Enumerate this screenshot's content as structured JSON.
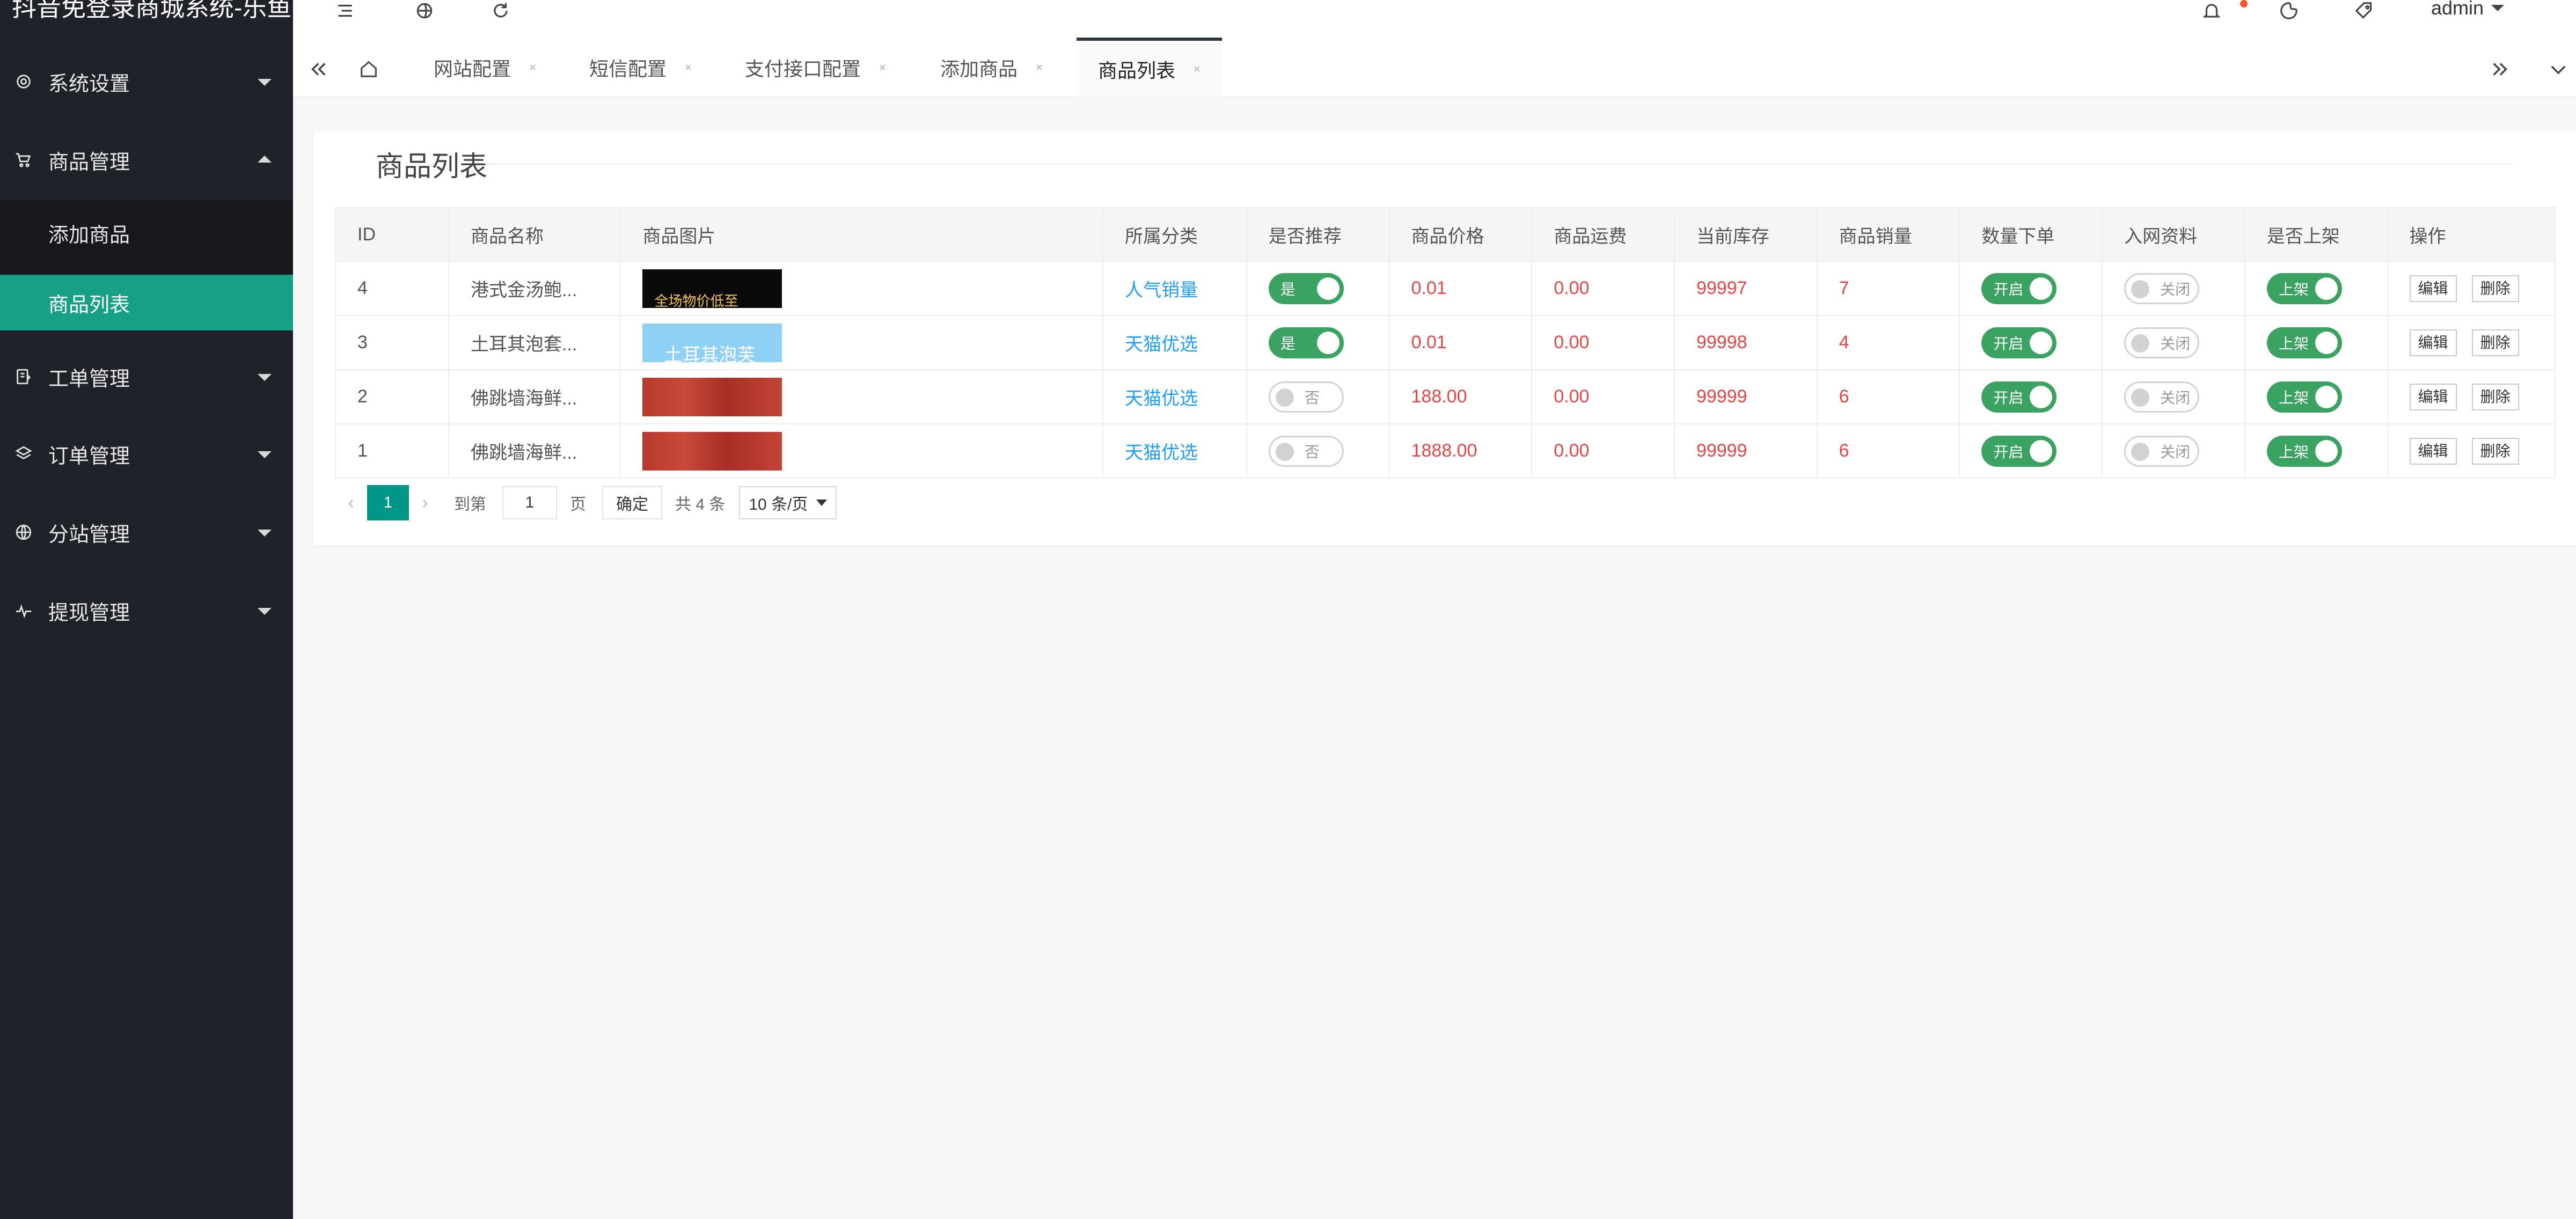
{
  "app": {
    "title": "抖音免登录商城系统-乐鱼"
  },
  "sidebar": {
    "items": [
      {
        "label": "系统设置",
        "icon": "settings-icon"
      },
      {
        "label": "商品管理",
        "icon": "cart-icon"
      },
      {
        "label": "工单管理",
        "icon": "ticket-icon"
      },
      {
        "label": "订单管理",
        "icon": "layers-icon"
      },
      {
        "label": "分站管理",
        "icon": "globe-icon"
      },
      {
        "label": "提现管理",
        "icon": "pulse-icon"
      }
    ],
    "submenu": [
      {
        "label": "添加商品"
      },
      {
        "label": "商品列表"
      }
    ]
  },
  "header": {
    "user": "admin"
  },
  "tabs": [
    {
      "label": "网站配置"
    },
    {
      "label": "短信配置"
    },
    {
      "label": "支付接口配置"
    },
    {
      "label": "添加商品"
    },
    {
      "label": "商品列表"
    }
  ],
  "card": {
    "title": "商品列表"
  },
  "table": {
    "headers": [
      "ID",
      "商品名称",
      "商品图片",
      "所属分类",
      "是否推荐",
      "商品价格",
      "商品运费",
      "当前库存",
      "商品销量",
      "数量下单",
      "入网资料",
      "是否上架",
      "操作"
    ],
    "rows": [
      {
        "id": "4",
        "name": "港式金汤鲍...",
        "image_text": "全场物价低至",
        "category": "人气销量",
        "recommend": "是",
        "price": "0.01",
        "shipping": "0.00",
        "stock": "99997",
        "sales": "7",
        "qty_order": "开启",
        "network": "关闭",
        "onsale": "上架"
      },
      {
        "id": "3",
        "name": "土耳其泡套...",
        "image_text": "土耳其泡芙",
        "category": "天猫优选",
        "recommend": "是",
        "price": "0.01",
        "shipping": "0.00",
        "stock": "99998",
        "sales": "4",
        "qty_order": "开启",
        "network": "关闭",
        "onsale": "上架"
      },
      {
        "id": "2",
        "name": "佛跳墙海鲜...",
        "image_text": "",
        "category": "天猫优选",
        "recommend": "否",
        "price": "188.00",
        "shipping": "0.00",
        "stock": "99999",
        "sales": "6",
        "qty_order": "开启",
        "network": "关闭",
        "onsale": "上架"
      },
      {
        "id": "1",
        "name": "佛跳墙海鲜...",
        "image_text": "",
        "category": "天猫优选",
        "recommend": "否",
        "price": "1888.00",
        "shipping": "0.00",
        "stock": "99999",
        "sales": "6",
        "qty_order": "开启",
        "network": "关闭",
        "onsale": "上架"
      }
    ],
    "edit_label": "编辑",
    "delete_label": "删除"
  },
  "pagination": {
    "current": "1",
    "goto_label": "到第",
    "goto_value": "1",
    "page_unit": "页",
    "confirm_label": "确定",
    "total_label": "共 4 条",
    "page_size": "10 条/页"
  },
  "colors": {
    "sidebar_bg": "#20222a",
    "accent": "#16a085",
    "switch_on": "#3aa362",
    "price_red": "#e84545",
    "link_blue": "#1e9fff"
  }
}
